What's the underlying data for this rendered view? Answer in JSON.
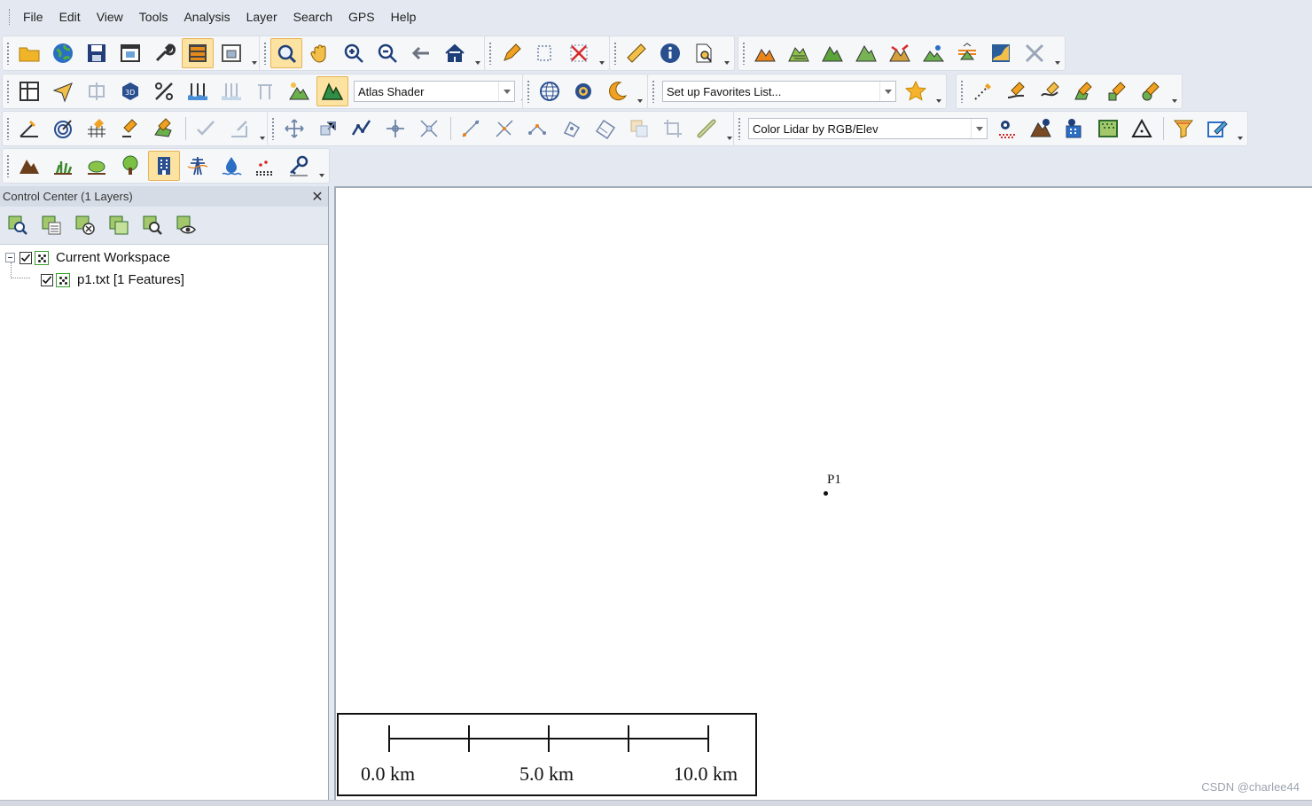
{
  "menu": [
    "File",
    "Edit",
    "View",
    "Tools",
    "Analysis",
    "Layer",
    "Search",
    "GPS",
    "Help"
  ],
  "toolbars": {
    "shader_combo": "Atlas Shader",
    "favorites_combo": "Set up Favorites List...",
    "lidar_combo": "Color Lidar by RGB/Elev"
  },
  "control_center": {
    "title": "Control Center (1 Layers)",
    "close_glyph": "✕",
    "tree": {
      "workspace_label": "Current Workspace",
      "layer_label": "p1.txt [1 Features]"
    }
  },
  "map": {
    "point_label": "P1",
    "scale_labels": [
      "0.0 km",
      "5.0 km",
      "10.0 km"
    ]
  },
  "watermark": "CSDN @charlee44",
  "colors": {
    "ui_background": "#e4e9f1",
    "active_button": "#fde3a1",
    "layer_icon_border": "#36a02a"
  }
}
